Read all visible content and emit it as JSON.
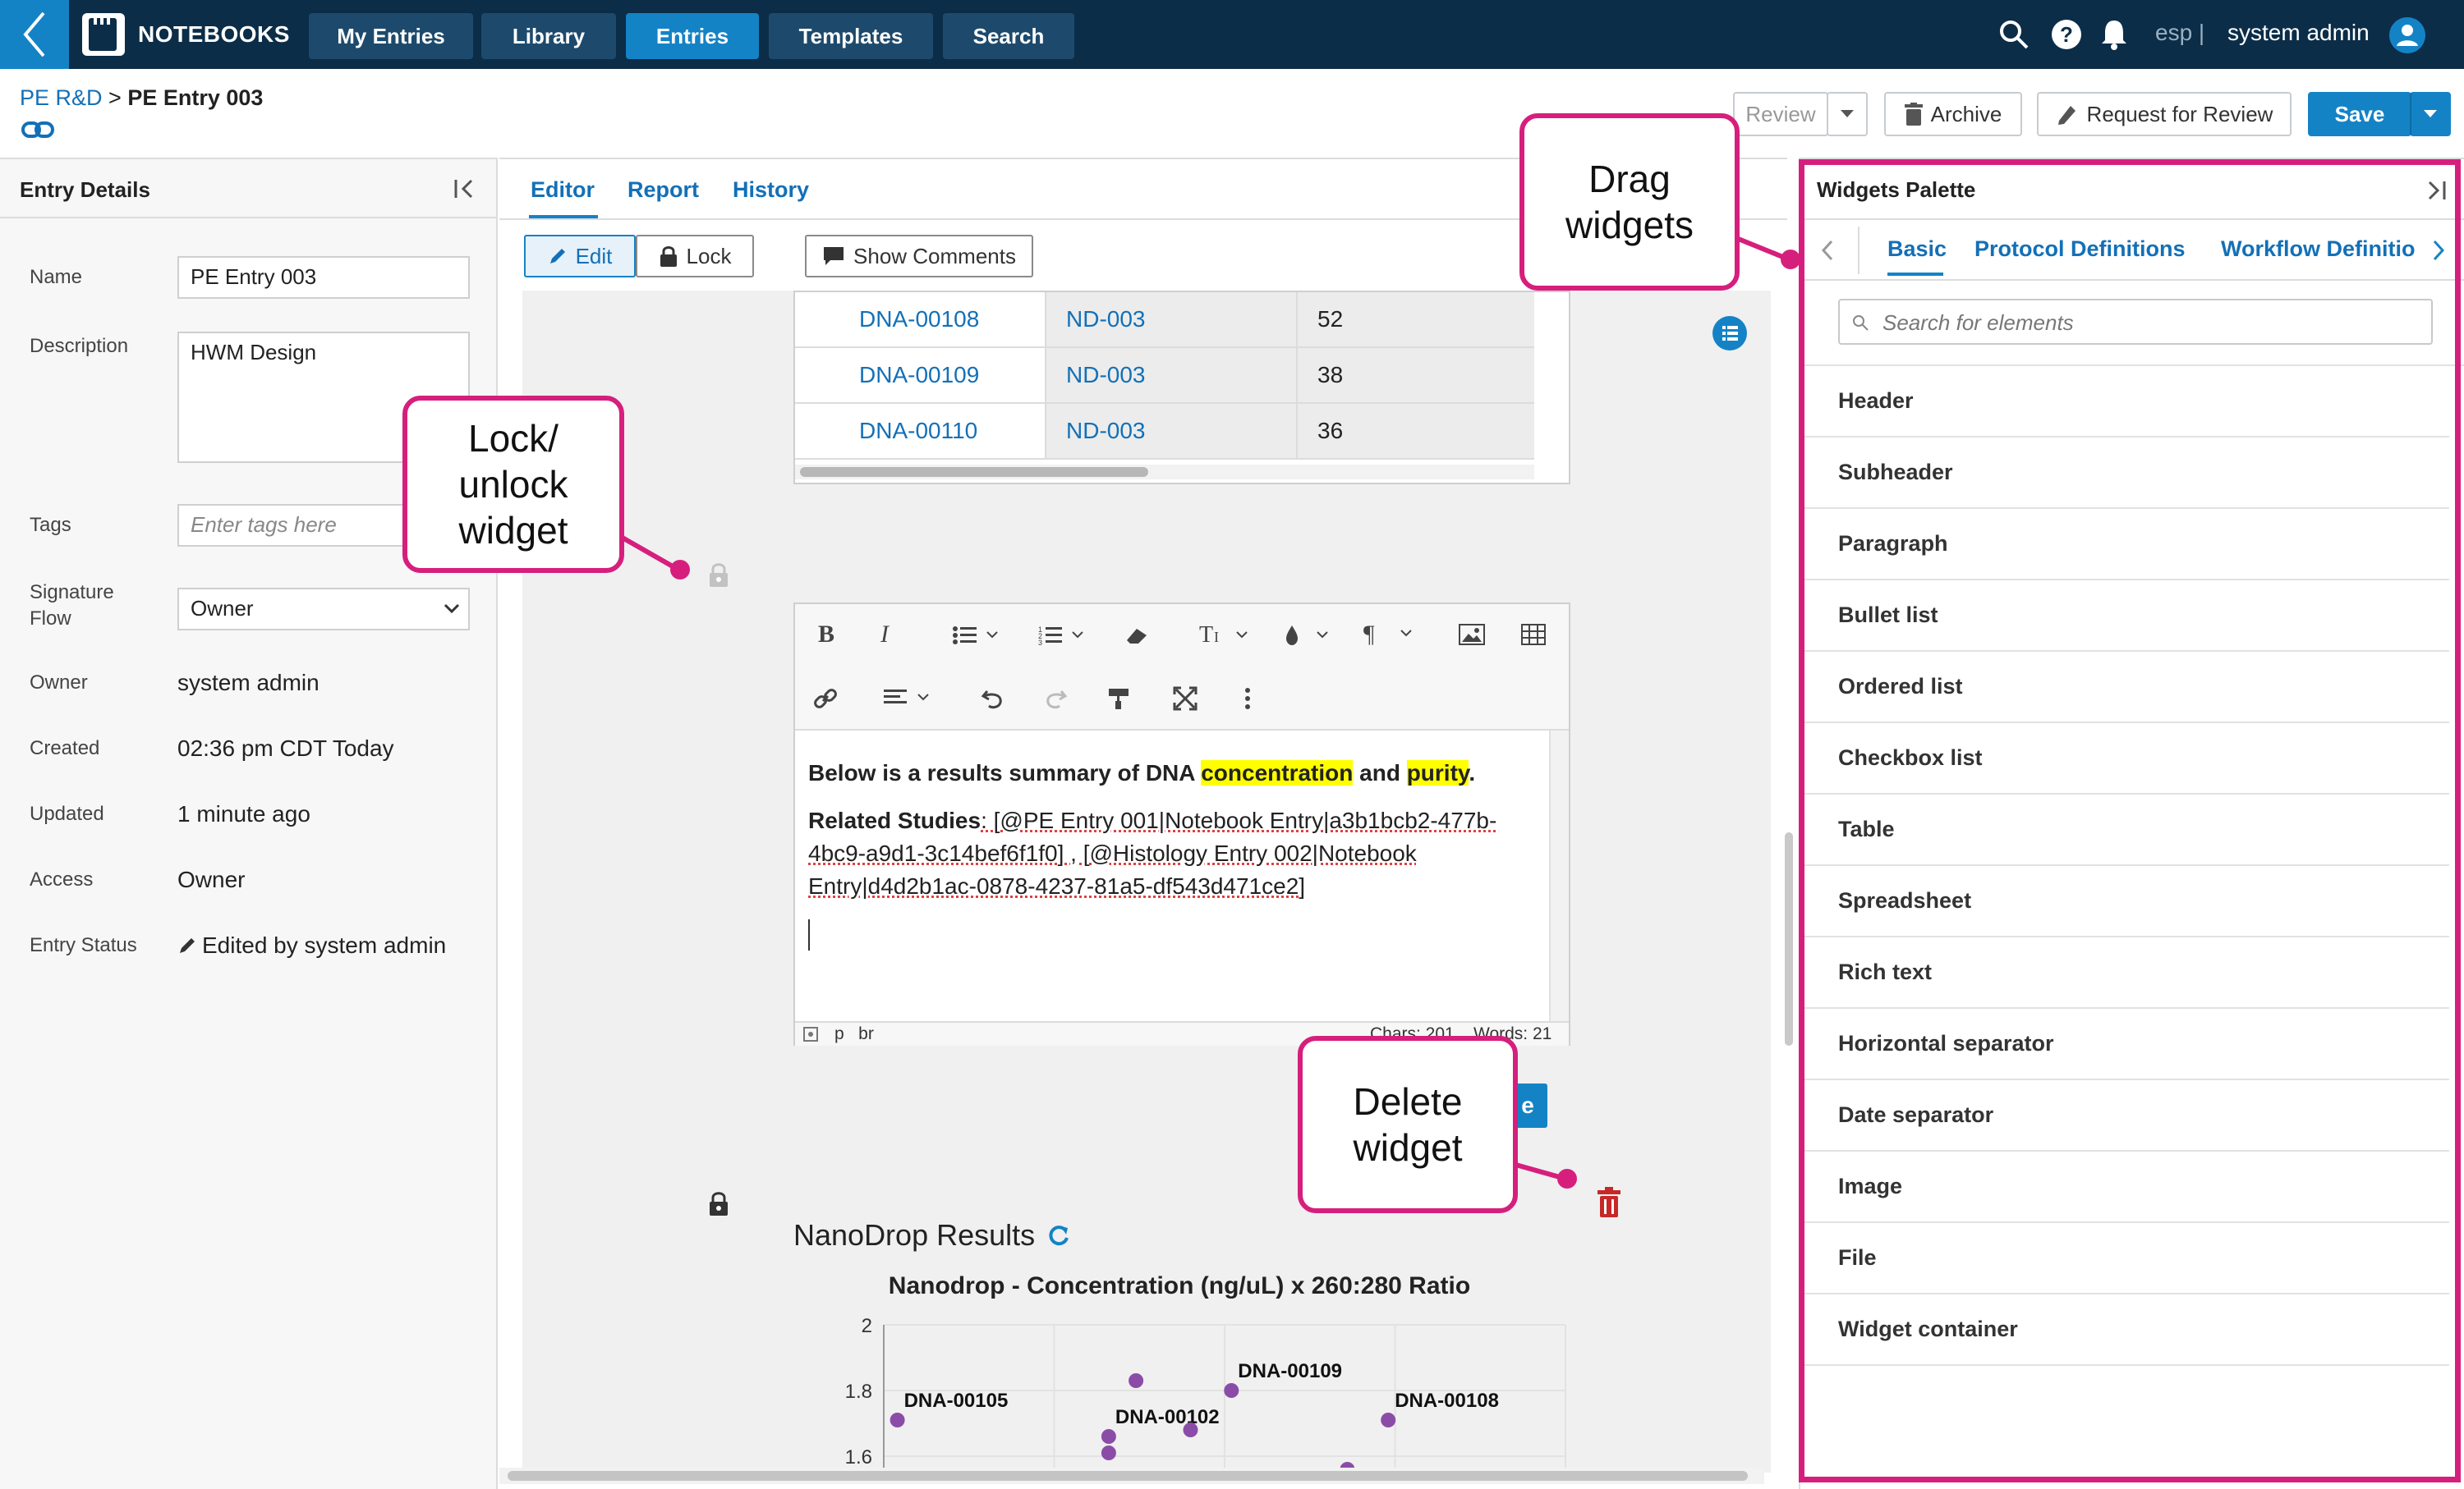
{
  "app": {
    "title": "NOTEBOOKS",
    "nav": [
      {
        "label": "My Entries",
        "active": false
      },
      {
        "label": "Library",
        "active": false
      },
      {
        "label": "Entries",
        "active": true
      },
      {
        "label": "Templates",
        "active": false
      },
      {
        "label": "Search",
        "active": false
      }
    ],
    "user": {
      "lang": "esp |",
      "name": "system admin"
    },
    "icons": [
      "back-chevron-icon",
      "notebook-logo-icon",
      "search-icon",
      "help-icon",
      "bell-icon",
      "user-avatar-icon"
    ]
  },
  "header": {
    "breadcrumb_root": "PE R&D",
    "breadcrumb_sep": ">",
    "breadcrumb_current": "PE Entry 003",
    "actions": {
      "review": "Review",
      "archive": "Archive",
      "request_review": "Request for Review",
      "save": "Save"
    }
  },
  "left_panel": {
    "title": "Entry Details",
    "fields": {
      "name": {
        "label": "Name",
        "value": "PE Entry 003"
      },
      "description": {
        "label": "Description",
        "value": "HWM Design"
      },
      "tags": {
        "label": "Tags",
        "placeholder": "Enter tags here"
      },
      "signature_flow": {
        "label": "Signature Flow",
        "value": "Owner"
      },
      "owner": {
        "label": "Owner",
        "value": "system admin"
      },
      "created": {
        "label": "Created",
        "value": "02:36 pm CDT Today"
      },
      "updated": {
        "label": "Updated",
        "value": "1 minute ago"
      },
      "access": {
        "label": "Access",
        "value": "Owner"
      },
      "entry_status": {
        "label": "Entry Status",
        "value": "Edited by system admin"
      }
    }
  },
  "editor": {
    "tabs": [
      "Editor",
      "Report",
      "History"
    ],
    "toolbar": {
      "edit": "Edit",
      "lock": "Lock",
      "show_comments": "Show Comments"
    },
    "table_rows": [
      [
        "DNA-00108",
        "ND-003",
        "52"
      ],
      [
        "DNA-00109",
        "ND-003",
        "38"
      ],
      [
        "DNA-00110",
        "ND-003",
        "36"
      ]
    ],
    "rich_text": {
      "line1_pre": "Below is a results summary of DNA ",
      "line1_h1": "concentration",
      "line1_mid": " and ",
      "line1_h2": "purity",
      "line1_end": ".",
      "related_label": "Related Studies",
      "related_text_1": ": [@PE Entry 001|Notebook Entry|a3b1bcb2-477b-",
      "related_text_2": "4bc9-a9d1-3c14bef6f1f0] , [@Histology Entry 002|Notebook",
      "related_text_3": "Entry|d4d2b1ac-0878-4237-81a5-df543d471ce2]",
      "status_tags": "p   br",
      "chars": "Chars: 201",
      "words": "Words: 21",
      "highlight_color": "#ffff00"
    },
    "hidden_button_fragment": "e",
    "widget_title": "NanoDrop Results"
  },
  "chart_data": {
    "type": "scatter",
    "title": "Nanodrop - Concentration (ng/uL) x 260:280 Ratio",
    "yticks": [
      2,
      1.8,
      1.6
    ],
    "ylim": [
      1.55,
      2.0
    ],
    "xlim": [
      0,
      1
    ],
    "color": "#8b4ca8",
    "points": [
      {
        "x": 0.02,
        "y": 1.71,
        "label": "DNA-00105"
      },
      {
        "x": 0.37,
        "y": 1.83,
        "label": ""
      },
      {
        "x": 0.33,
        "y": 1.66,
        "label": "DNA-00102"
      },
      {
        "x": 0.33,
        "y": 1.61,
        "label": ""
      },
      {
        "x": 0.45,
        "y": 1.68,
        "label": ""
      },
      {
        "x": 0.51,
        "y": 1.8,
        "label": "DNA-00109"
      },
      {
        "x": 0.74,
        "y": 1.71,
        "label": "DNA-00108"
      },
      {
        "x": 0.68,
        "y": 1.56,
        "label": ""
      }
    ]
  },
  "palette": {
    "title": "Widgets Palette",
    "tabs": [
      "Basic",
      "Protocol Definitions",
      "Workflow Definitio"
    ],
    "search_placeholder": "Search for elements",
    "items": [
      "Header",
      "Subheader",
      "Paragraph",
      "Bullet list",
      "Ordered list",
      "Checkbox list",
      "Table",
      "Spreadsheet",
      "Rich text",
      "Horizontal separator",
      "Date separator",
      "Image",
      "File",
      "Widget container"
    ]
  },
  "callouts": {
    "drag": "Drag widgets",
    "lock": "Lock/ unlock widget",
    "delete": "Delete widget",
    "accent": "#d61f7d"
  }
}
